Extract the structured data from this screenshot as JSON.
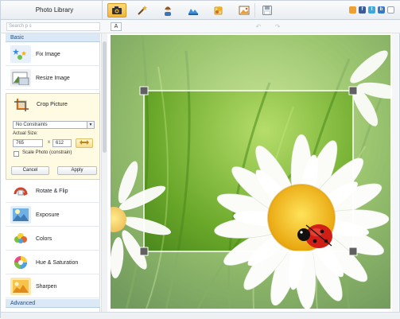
{
  "header": {
    "title": "Photo Library",
    "tools": [
      {
        "name": "camera-icon",
        "active": true
      },
      {
        "name": "magic-wand-icon",
        "active": false
      },
      {
        "name": "person-icon",
        "active": false
      },
      {
        "name": "frame-icon",
        "active": false
      },
      {
        "name": "stickers-icon",
        "active": false
      },
      {
        "name": "picture-icon",
        "active": false
      },
      {
        "name": "save-icon",
        "active": false
      }
    ],
    "share": [
      {
        "name": "share-icon",
        "label": "",
        "color": "#f0a030"
      },
      {
        "name": "facebook-icon",
        "label": "f",
        "color": "#3b5b9a"
      },
      {
        "name": "twitter-icon",
        "label": "t",
        "color": "#3fa7d9"
      },
      {
        "name": "blogger-icon",
        "label": "b",
        "color": "#3579c8"
      },
      {
        "name": "email-icon",
        "label": "",
        "color": "#9aa3ad"
      }
    ]
  },
  "toolbar": {
    "search_placeholder": "Search p s",
    "fit_label": "A"
  },
  "sidebar": {
    "basic_label": "Basic",
    "advanced_label": "Advanced",
    "items": [
      {
        "label": "Fix Image",
        "icon": "fix-image-icon"
      },
      {
        "label": "Resize Image",
        "icon": "resize-icon"
      },
      {
        "label": "Rotate & Flip",
        "icon": "rotate-icon"
      },
      {
        "label": "Exposure",
        "icon": "exposure-icon"
      },
      {
        "label": "Colors",
        "icon": "colors-icon"
      },
      {
        "label": "Hue & Saturation",
        "icon": "hue-saturation-icon"
      },
      {
        "label": "Sharpen",
        "icon": "sharpen-icon"
      }
    ],
    "crop": {
      "label": "Crop Picture",
      "constraint": "No Constraints",
      "actual_size_label": "Actual Size:",
      "width": "765",
      "x": "x",
      "height": "612",
      "scale_label": "Scale Photo (constrain)",
      "cancel_label": "Cancel",
      "apply_label": "Apply"
    }
  },
  "colors": {
    "accent": "#f3b63a",
    "section": "#dbe8f6",
    "crop_panel": "#fffbe3"
  }
}
